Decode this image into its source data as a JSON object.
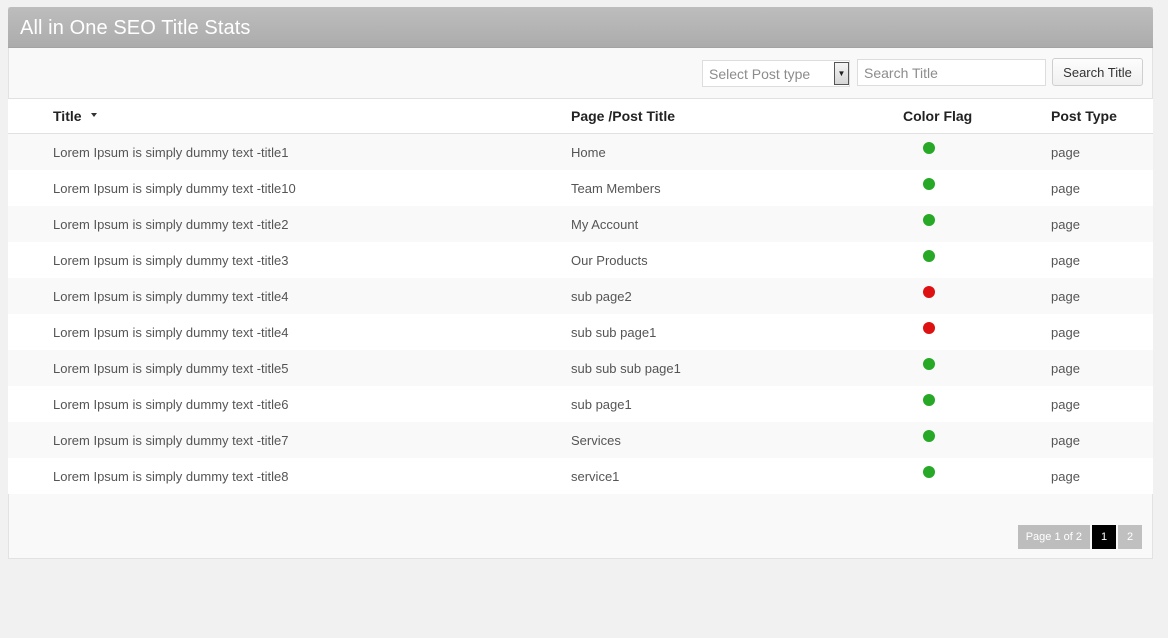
{
  "panel": {
    "title": "All in One SEO Title Stats"
  },
  "toolbar": {
    "post_type_select": "Select Post type",
    "search_placeholder": "Search Title",
    "search_button_label": "Search Title"
  },
  "table": {
    "columns": [
      "Title",
      "Page /Post Title",
      "Color Flag",
      "Post Type"
    ],
    "sorted_column": "Title",
    "sort_direction": "desc",
    "rows": [
      {
        "title": "Lorem Ipsum is simply dummy text -title1",
        "page_title": "Home",
        "flag": "green",
        "post_type": "page"
      },
      {
        "title": "Lorem Ipsum is simply dummy text -title10",
        "page_title": "Team Members",
        "flag": "green",
        "post_type": "page"
      },
      {
        "title": "Lorem Ipsum is simply dummy text -title2",
        "page_title": "My Account",
        "flag": "green",
        "post_type": "page"
      },
      {
        "title": "Lorem Ipsum is simply dummy text -title3",
        "page_title": "Our Products",
        "flag": "green",
        "post_type": "page"
      },
      {
        "title": "Lorem Ipsum is simply dummy text -title4",
        "page_title": "sub page2",
        "flag": "red",
        "post_type": "page"
      },
      {
        "title": "Lorem Ipsum is simply dummy text -title4",
        "page_title": "sub sub page1",
        "flag": "red",
        "post_type": "page"
      },
      {
        "title": "Lorem Ipsum is simply dummy text -title5",
        "page_title": "sub sub sub page1",
        "flag": "green",
        "post_type": "page"
      },
      {
        "title": "Lorem Ipsum is simply dummy text -title6",
        "page_title": "sub page1",
        "flag": "green",
        "post_type": "page"
      },
      {
        "title": "Lorem Ipsum is simply dummy text -title7",
        "page_title": "Services",
        "flag": "green",
        "post_type": "page"
      },
      {
        "title": "Lorem Ipsum is simply dummy text -title8",
        "page_title": "service1",
        "flag": "green",
        "post_type": "page"
      }
    ]
  },
  "pagination": {
    "info": "Page 1 of 2",
    "pages": [
      "1",
      "2"
    ],
    "current_page": "1"
  },
  "colors": {
    "header_bg": "#b3b3b3",
    "flag_green": "#27a827",
    "flag_red": "#dd1111",
    "active_page": "#000000",
    "inactive_page": "#c0c0c0"
  }
}
